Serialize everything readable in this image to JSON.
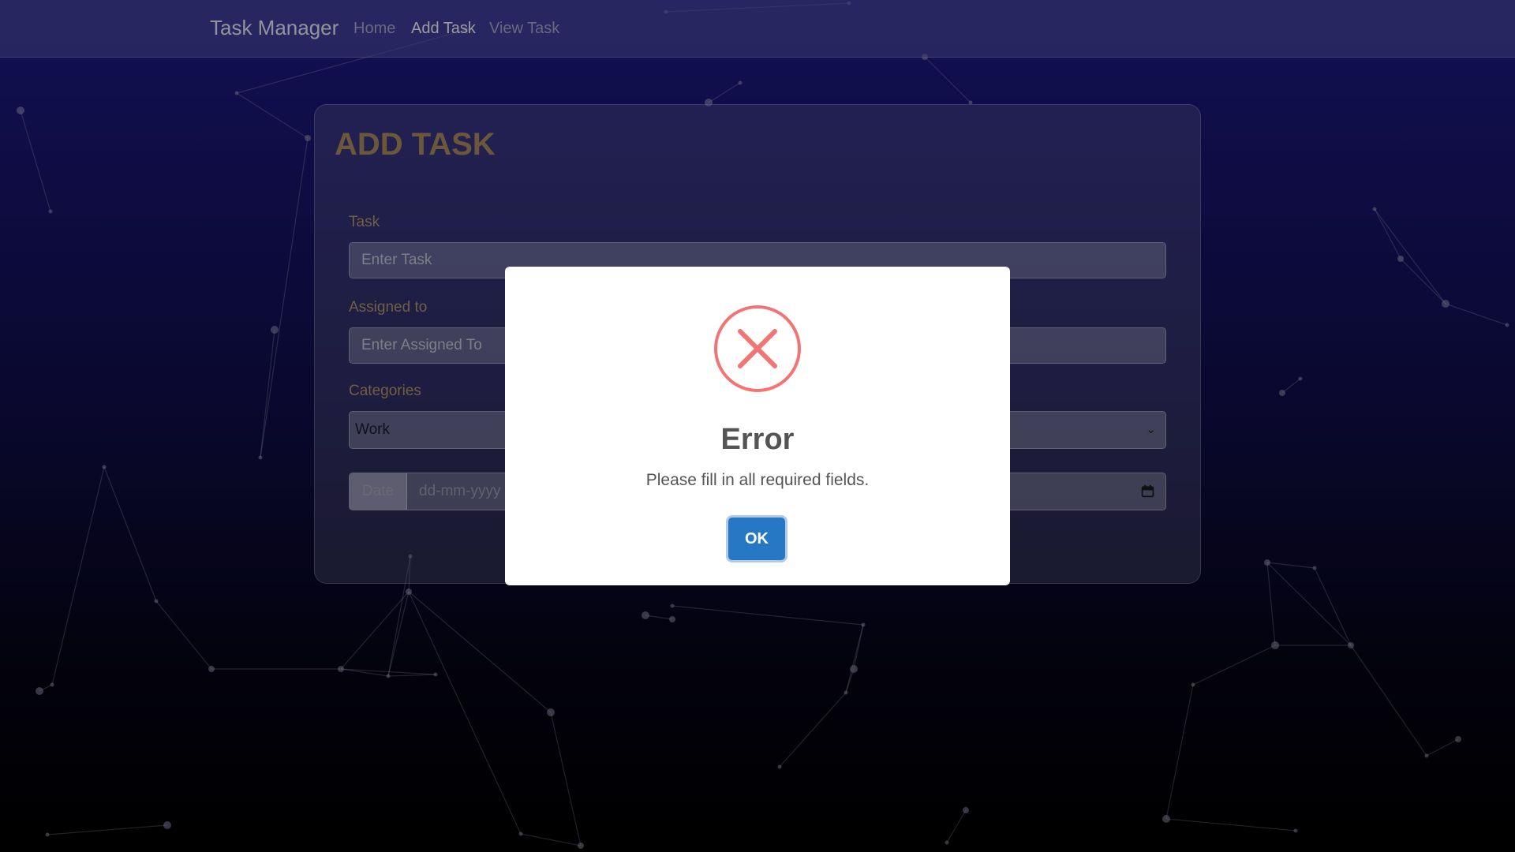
{
  "navbar": {
    "brand": "Task Manager",
    "links": [
      {
        "label": "Home",
        "active": false
      },
      {
        "label": "Add Task",
        "active": true
      },
      {
        "label": "View Task",
        "active": false
      }
    ]
  },
  "form": {
    "title": "ADD TASK",
    "task": {
      "label": "Task",
      "placeholder": "Enter Task"
    },
    "assigned": {
      "label": "Assigned to",
      "placeholder": "Enter Assigned To"
    },
    "categories": {
      "label": "Categories",
      "selected": "Work"
    },
    "date": {
      "addon": "Date",
      "placeholder": "dd-mm-yyyy"
    }
  },
  "dialog": {
    "icon": "error-x-icon",
    "title": "Error",
    "message": "Please fill in all required fields.",
    "button": "OK"
  },
  "colors": {
    "accent_gold": "#a88a5c",
    "error_red": "#f27474",
    "ok_blue": "#2778c4",
    "bg_top": "#1f1a85",
    "bg_bottom": "#000000"
  }
}
